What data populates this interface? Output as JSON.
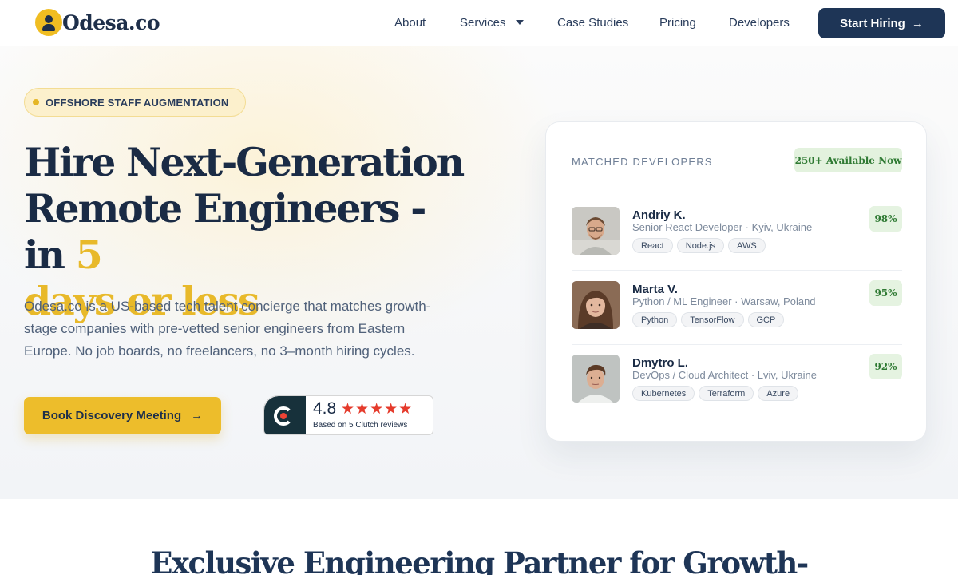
{
  "header": {
    "logo_text": "Odesa.co",
    "nav": {
      "about": "About",
      "services": "Services",
      "case_studies": "Case Studies",
      "pricing": "Pricing",
      "developers": "Developers"
    },
    "cta_label": "Start Hiring"
  },
  "hero": {
    "badge": "OFFSHORE STAFF AUGMENTATION",
    "headline_line1": "Hire Next-Generation",
    "headline_line2": "Remote Engineers - in ",
    "headline_accent1": "5",
    "headline_accent2": "days or less",
    "description": "Odesa.co is a US-based tech talent concierge that matches growth-stage companies with pre-vetted senior engineers from Eastern Europe. No job boards, no freelancers, no 3–month hiring cycles.",
    "cta_label": "Book Discovery Meeting",
    "clutch": {
      "score": "4.8",
      "stars": "★★★★★",
      "reviews": "Based on 5 Clutch reviews"
    }
  },
  "card": {
    "label": "MATCHED DEVELOPERS",
    "available": "250+ Available Now",
    "developers": [
      {
        "name": "Andriy K.",
        "role": "Senior React Developer · Kyiv, Ukraine",
        "tags": [
          "React",
          "Node.js",
          "AWS"
        ],
        "match": "98%"
      },
      {
        "name": "Marta V.",
        "role": "Python / ML Engineer · Warsaw, Poland",
        "tags": [
          "Python",
          "TensorFlow",
          "GCP"
        ],
        "match": "95%"
      },
      {
        "name": "Dmytro L.",
        "role": "DevOps / Cloud Architect · Lviv, Ukraine",
        "tags": [
          "Kubernetes",
          "Terraform",
          "Azure"
        ],
        "match": "92%"
      }
    ]
  },
  "section": {
    "title": "Exclusive Engineering Partner for Growth-"
  },
  "colors": {
    "navy": "#1e3556",
    "accent_yellow": "#edbd2b",
    "match_green": "#2f7a33",
    "clutch_red": "#e53b2c"
  },
  "icons": [
    "logo-mark-icon",
    "chevron-down-icon",
    "arrow-right-icon",
    "clutch-logo-icon",
    "star-icon"
  ]
}
